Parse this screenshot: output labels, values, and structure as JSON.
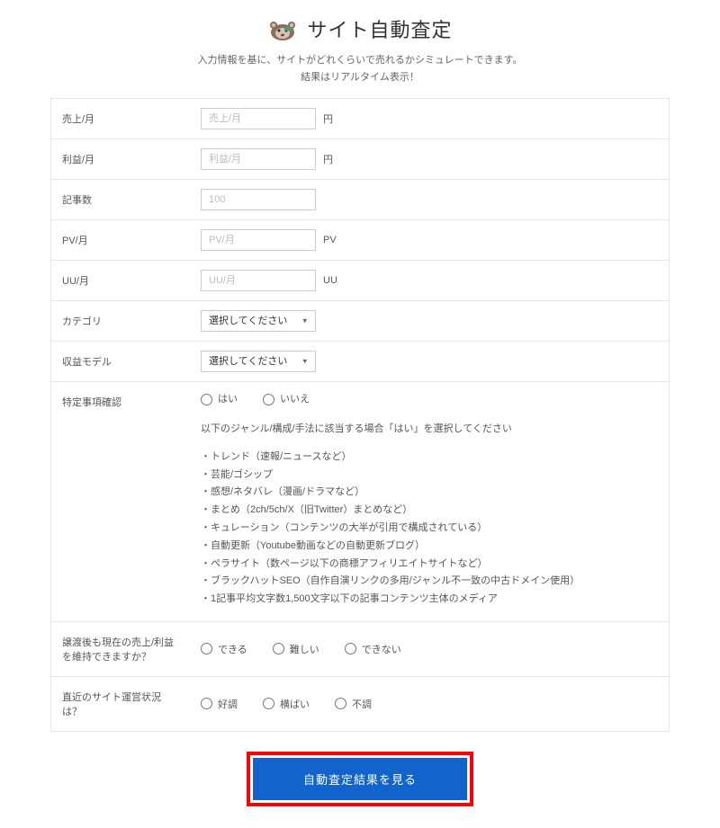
{
  "header": {
    "title": "サイト自動査定",
    "subtitle1": "入力情報を基に、サイトがどれくらいで売れるかシミュレートできます。",
    "subtitle2": "結果はリアルタイム表示！"
  },
  "fields": {
    "sales": {
      "label": "売上/月",
      "placeholder": "売上/月",
      "unit": "円"
    },
    "profit": {
      "label": "利益/月",
      "placeholder": "利益/月",
      "unit": "円"
    },
    "articles": {
      "label": "記事数",
      "placeholder": "100"
    },
    "pv": {
      "label": "PV/月",
      "placeholder": "PV/月",
      "unit": "PV"
    },
    "uu": {
      "label": "UU/月",
      "placeholder": "UU/月",
      "unit": "UU"
    },
    "category": {
      "label": "カテゴリ",
      "placeholder": "選択してください"
    },
    "revenue_model": {
      "label": "収益モデル",
      "placeholder": "選択してください"
    },
    "special": {
      "label": "特定事項確認",
      "yes": "はい",
      "no": "いいえ",
      "desc": "以下のジャンル/構成/手法に該当する場合「はい」を選択してください",
      "items": [
        "トレンド（速報/ニュースなど）",
        "芸能/ゴシップ",
        "感想/ネタバレ（漫画/ドラマなど）",
        "まとめ（2ch/5ch/X（旧Twitter）まとめなど）",
        "キュレーション（コンテンツの大半が引用で構成されている）",
        "自動更新（Youtube動画などの自動更新ブログ）",
        "ペラサイト（数ページ以下の商標アフィリエイトサイトなど）",
        "ブラックハットSEO（自作自演リンクの多用/ジャンル不一致の中古ドメイン使用）",
        "1記事平均文字数1,500文字以下の記事コンテンツ主体のメディア"
      ]
    },
    "transfer": {
      "label": "譲渡後も現在の売上/利益を維持できますか？",
      "options": {
        "can": "できる",
        "hard": "難しい",
        "cannot": "できない"
      }
    },
    "recent": {
      "label": "直近のサイト運営状況は？",
      "options": {
        "good": "好調",
        "flat": "横ばい",
        "bad": "不調"
      }
    }
  },
  "button": {
    "submit": "自動査定結果を見る"
  }
}
